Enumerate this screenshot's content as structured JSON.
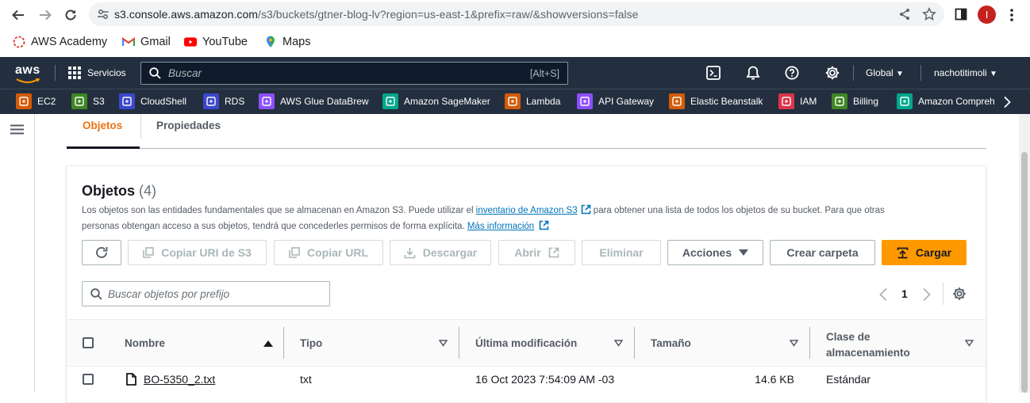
{
  "browser": {
    "url_host": "s3.console.aws.amazon.com",
    "url_path": "/s3/buckets/gtner-blog-lv?region=us-east-1&prefix=raw/&showversions=false",
    "profile_initial": "I",
    "bookmarks": [
      "AWS Academy",
      "Gmail",
      "YouTube",
      "Maps"
    ]
  },
  "aws_nav": {
    "logo": "aws",
    "services_label": "Servicios",
    "search_placeholder": "Buscar",
    "search_shortcut": "[Alt+S]",
    "region": "Global",
    "account": "nachotitimoli"
  },
  "favorites": [
    {
      "label": "EC2",
      "color": "#d45b07",
      "icon": "ec2-icon"
    },
    {
      "label": "S3",
      "color": "#3f8624",
      "icon": "s3-icon"
    },
    {
      "label": "CloudShell",
      "color": "#3b48cc",
      "icon": "cloudshell-icon"
    },
    {
      "label": "RDS",
      "color": "#3b48cc",
      "icon": "rds-icon"
    },
    {
      "label": "AWS Glue DataBrew",
      "color": "#8c4fff",
      "icon": "glue-databrew-icon"
    },
    {
      "label": "Amazon SageMaker",
      "color": "#01a88d",
      "icon": "sagemaker-icon"
    },
    {
      "label": "Lambda",
      "color": "#d45b07",
      "icon": "lambda-icon"
    },
    {
      "label": "API Gateway",
      "color": "#8c4fff",
      "icon": "api-gateway-icon"
    },
    {
      "label": "Elastic Beanstalk",
      "color": "#d45b07",
      "icon": "beanstalk-icon"
    },
    {
      "label": "IAM",
      "color": "#dd344c",
      "icon": "iam-icon"
    },
    {
      "label": "Billing",
      "color": "#3f8624",
      "icon": "billing-icon"
    },
    {
      "label": "Amazon Compreh",
      "color": "#01a88d",
      "icon": "comprehend-icon"
    }
  ],
  "tabs": [
    {
      "label": "Objetos",
      "active": true
    },
    {
      "label": "Propiedades",
      "active": false
    }
  ],
  "objects": {
    "title": "Objetos",
    "count": "(4)",
    "desc_1_a": "Los objetos son las entidades fundamentales que se almacenan en Amazon S3. Puede utilizar el ",
    "desc_1_link": "inventario de Amazon S3",
    "desc_1_b": " para obtener una lista de todos los objetos de su bucket. Para que otras",
    "desc_2_a": "personas obtengan acceso a sus objetos, tendrá que concederles permisos de forma explícita. ",
    "desc_2_link": "Más información",
    "buttons": {
      "copy_uri": "Copiar URI de S3",
      "copy_url": "Copiar URL",
      "download": "Descargar",
      "open": "Abrir",
      "delete": "Eliminar",
      "actions": "Acciones",
      "create_folder": "Crear carpeta",
      "upload": "Cargar"
    },
    "search_placeholder": "Buscar objetos por prefijo",
    "page": "1",
    "columns": {
      "name": "Nombre",
      "type": "Tipo",
      "modified": "Última modificación",
      "size": "Tamaño",
      "storage_1": "Clase de",
      "storage_2": "almacenamiento"
    },
    "rows": [
      {
        "name": "BO-5350_2.txt",
        "type": "txt",
        "modified": "16 Oct 2023 7:54:09 AM -03",
        "size": "14.6 KB",
        "storage": "Estándar"
      }
    ]
  },
  "colors": {
    "aws_nav": "#232f3e",
    "primary": "#ff9900",
    "link": "#0073bb",
    "active_tab": "#ec7211"
  }
}
